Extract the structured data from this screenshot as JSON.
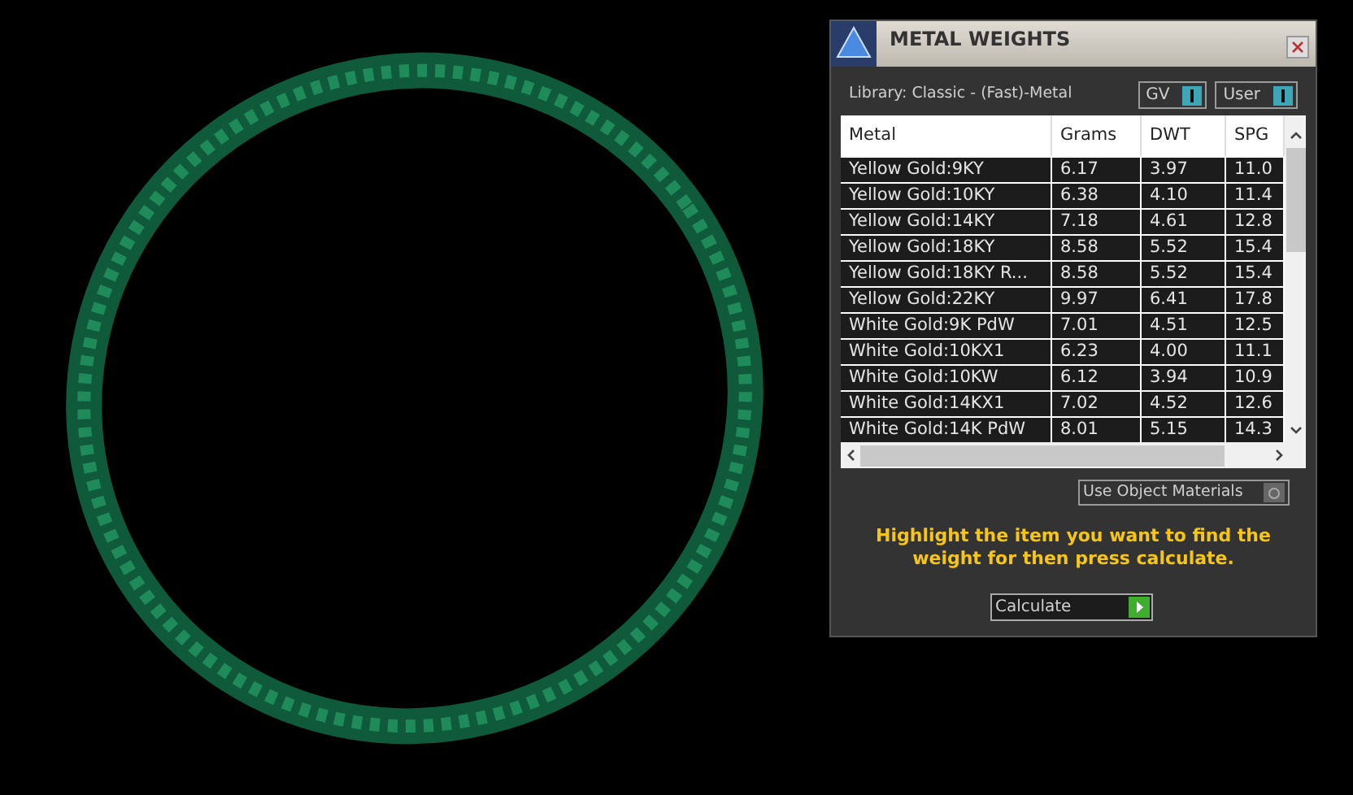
{
  "window": {
    "title": "METAL WEIGHTS"
  },
  "library": "Library: Classic - (Fast)-Metal",
  "toggles": [
    {
      "label": "GV",
      "on": true
    },
    {
      "label": "User",
      "on": true
    }
  ],
  "table": {
    "columns": [
      "Metal",
      "Grams",
      "DWT",
      "SPG"
    ],
    "rows": [
      [
        "Yellow Gold:9KY",
        "6.17",
        "3.97",
        "11.0"
      ],
      [
        "Yellow Gold:10KY",
        "6.38",
        "4.10",
        "11.4"
      ],
      [
        "Yellow Gold:14KY",
        "7.18",
        "4.61",
        "12.8"
      ],
      [
        "Yellow Gold:18KY",
        "8.58",
        "5.52",
        "15.4"
      ],
      [
        "Yellow Gold:18KY R...",
        "8.58",
        "5.52",
        "15.4"
      ],
      [
        "Yellow Gold:22KY",
        "9.97",
        "6.41",
        "17.8"
      ],
      [
        "White Gold:9K PdW",
        "7.01",
        "4.51",
        "12.5"
      ],
      [
        "White Gold:10KX1",
        "6.23",
        "4.00",
        "11.1"
      ],
      [
        "White Gold:10KW",
        "6.12",
        "3.94",
        "10.9"
      ],
      [
        "White Gold:14KX1",
        "7.02",
        "4.52",
        "12.6"
      ],
      [
        "White Gold:14K PdW",
        "8.01",
        "5.15",
        "14.3"
      ]
    ]
  },
  "use_object_materials": {
    "label": "Use Object Materials",
    "on": false
  },
  "hint": "Highlight the item you want to find the weight for then press calculate.",
  "calculate_button": "Calculate"
}
